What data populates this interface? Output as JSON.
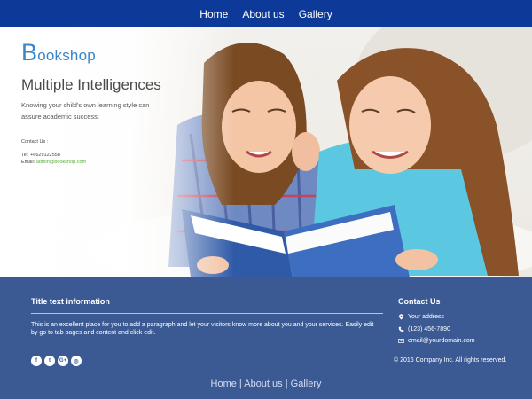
{
  "top_nav": {
    "items": [
      {
        "label": "Home"
      },
      {
        "label": "About us"
      },
      {
        "label": "Gallery"
      }
    ]
  },
  "hero": {
    "logo_initial": "B",
    "logo_rest": "ookshop",
    "title": "Multiple Intelligences",
    "description": "Knowing your child's own learning style can assure academic success.",
    "contact_label": "Contact Us :",
    "tel": "Tel: +6629122558",
    "email_prefix": "Email: ",
    "email": "admin@bookshop.com",
    "image_subject": "two girls reading a blue book"
  },
  "footer": {
    "title": "Title text information",
    "text": "This is an excellent place for you to add a paragraph and let your visitors know more about you and your services. Easily edit by go to tab pages and content and click edit.",
    "social_icons": [
      "facebook-icon",
      "twitter-icon",
      "google-plus-icon",
      "instagram-icon"
    ],
    "contact": {
      "title": "Contact Us",
      "address": "Your address",
      "phone": "(123) 456-7890",
      "email": "email@yourdomain.com",
      "copyright": "© 2016 Company Inc. All rights reserved."
    }
  },
  "bottom_nav": {
    "items": [
      {
        "label": "Home"
      },
      {
        "label": "About us"
      },
      {
        "label": "Gallery"
      }
    ],
    "separator": " | "
  },
  "colors": {
    "nav_bg": "#0d3a98",
    "footer_bg": "#3b5a94",
    "logo_blue": "#3a86c8",
    "email_green": "#5bab3b"
  }
}
